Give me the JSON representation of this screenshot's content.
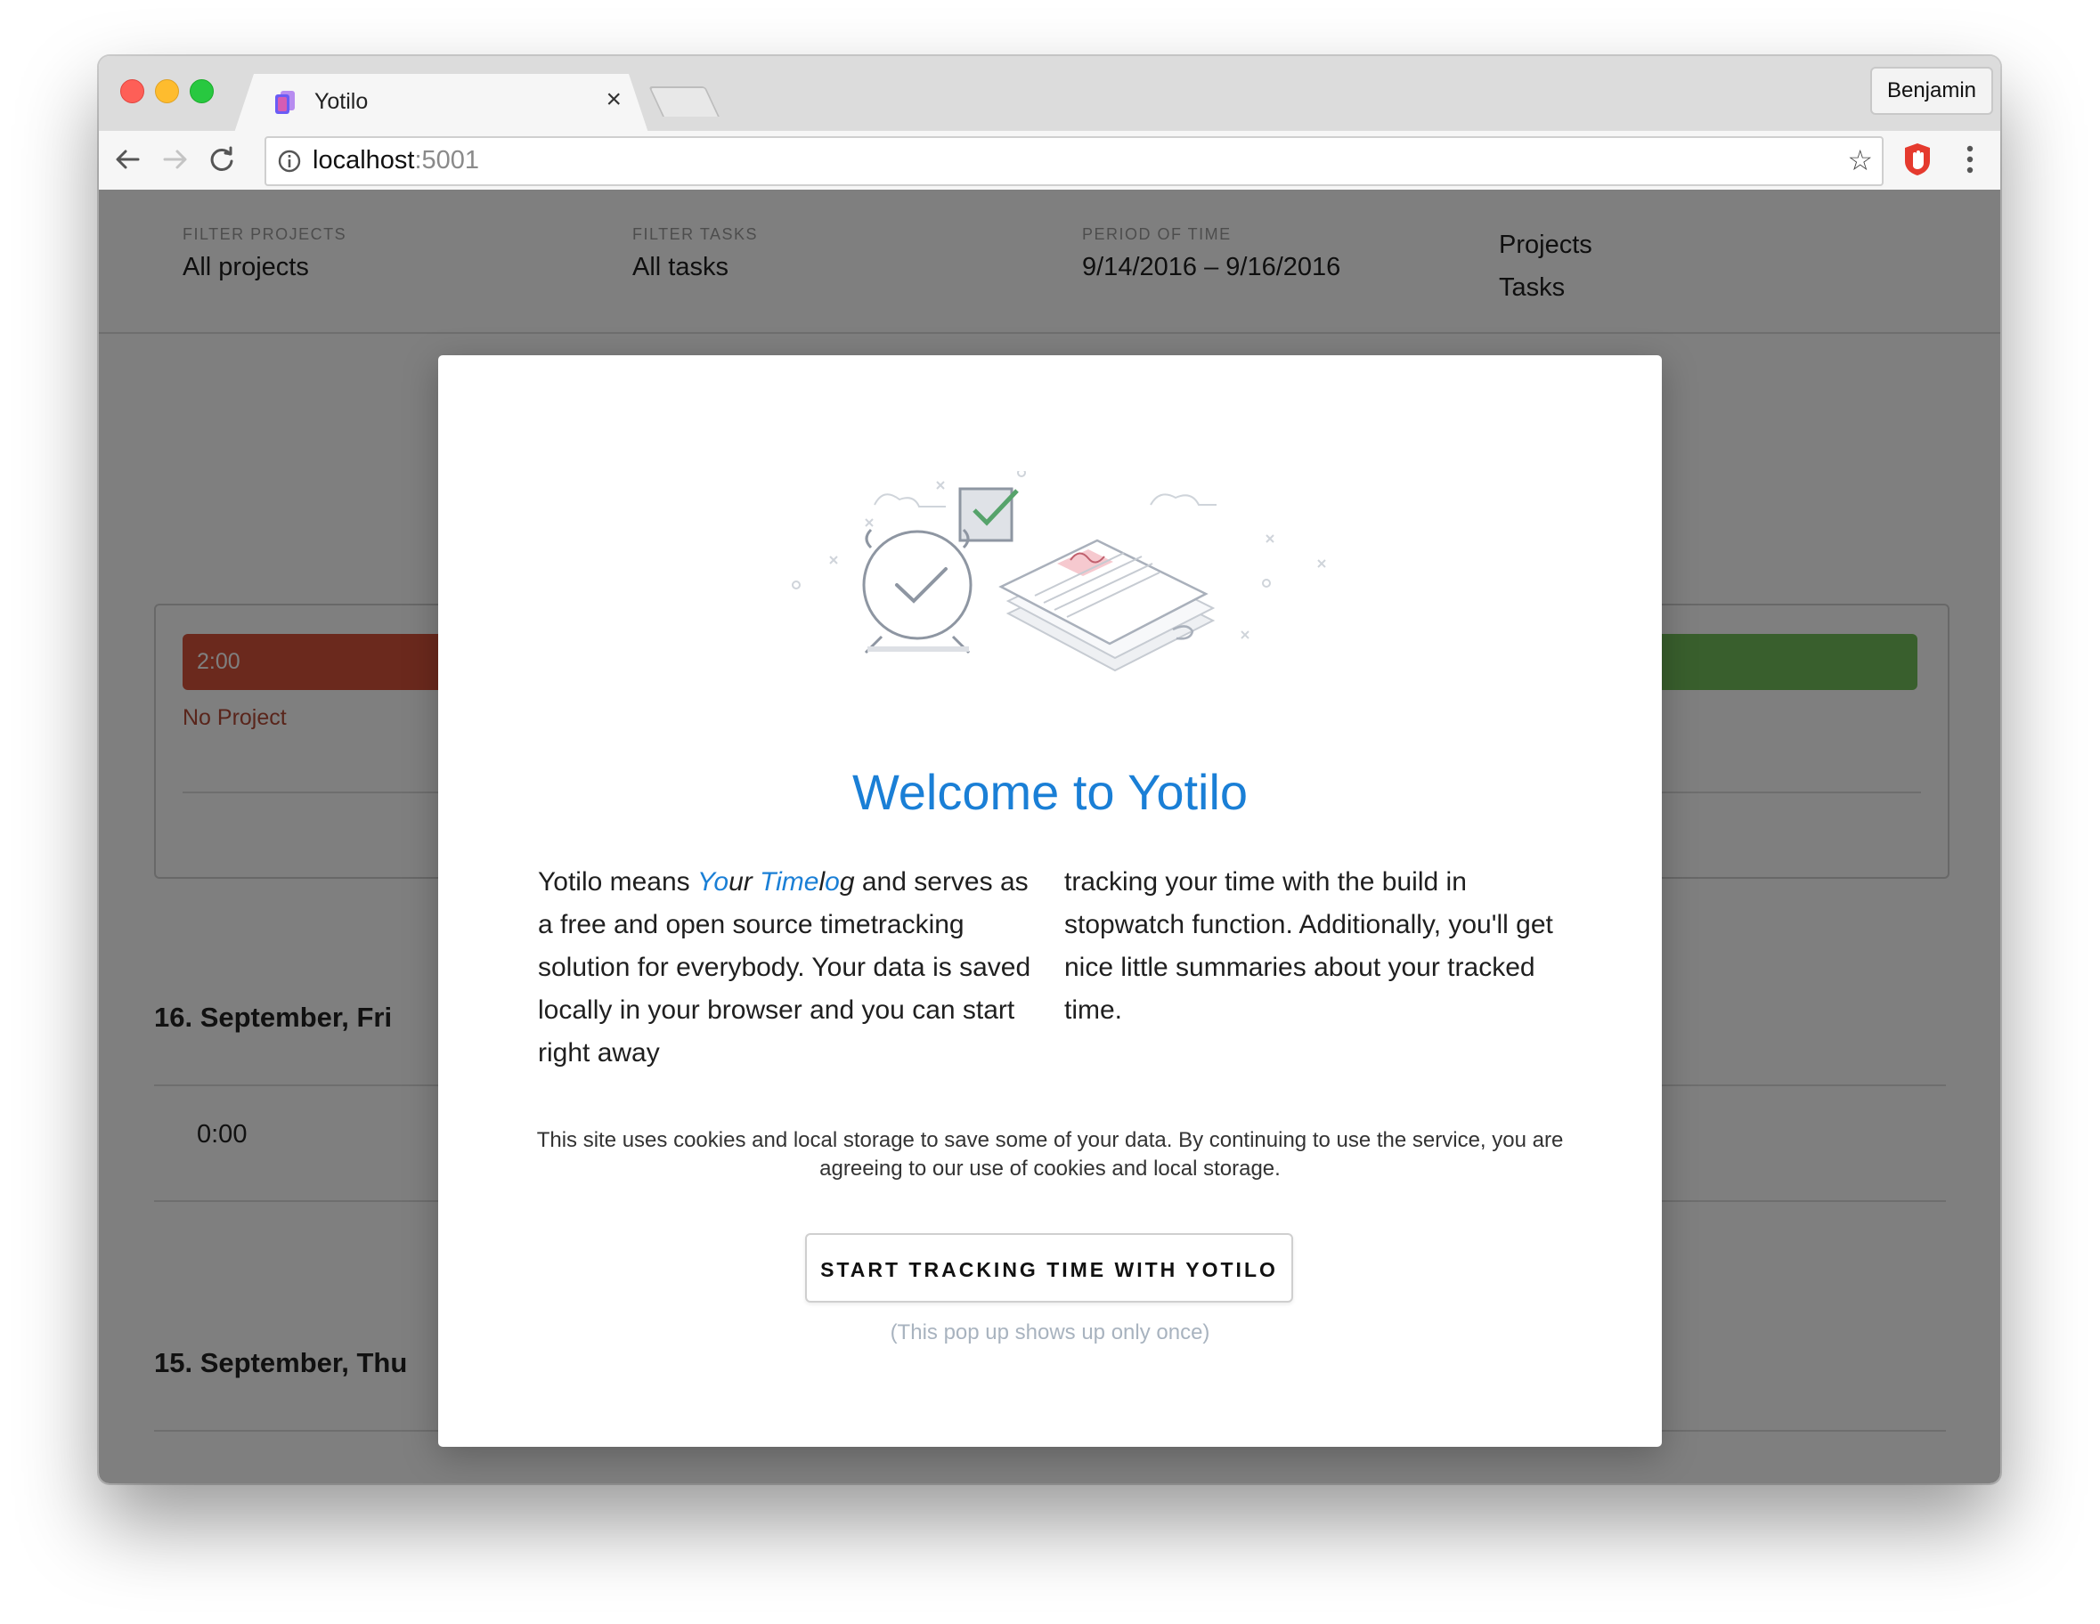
{
  "browser": {
    "tab_title": "Yotilo",
    "tab_close": "×",
    "profile_name": "Benjamin",
    "url_host": "localhost",
    "url_port": ":5001",
    "star": "☆"
  },
  "filters": {
    "projects_label": "Filter Projects",
    "projects_value": "All projects",
    "tasks_label": "Filter Tasks",
    "tasks_value": "All tasks",
    "period_label": "Period of time",
    "period_value": "9/14/2016 – 9/16/2016"
  },
  "nav": {
    "projects": "Projects",
    "tasks": "Tasks"
  },
  "summary": {
    "bar_time": "2:00",
    "project_name": "No Project",
    "bar_red_color": "#d6523a",
    "bar_green_color": "#73bf5b"
  },
  "days": [
    {
      "heading": "16. September, Fri",
      "entry_time": "0:00"
    },
    {
      "heading": "15. September, Thu"
    }
  ],
  "modal": {
    "title": "Welcome to Yotilo",
    "intro_before": "Yotilo means ",
    "your_hl": "Yo",
    "your_rest": "ur ",
    "time_hl": "Time",
    "log_l": "l",
    "log_o": "o",
    "log_g": "g",
    "intro_after": " and serves as a free and open source timetracking solution for everybody. Your data is saved locally in your browser and you can start right away",
    "intro_col2": "tracking your time with the build in stopwatch function. Additionally, you'll get nice little summaries about your tracked time.",
    "cookie_notice": "This site uses cookies and local storage to save some of your data. By continuing to use the service, you are agreeing to our use of cookies and local storage.",
    "cta_label": "START TRACKING TIME WITH YOTILO",
    "once_note": "(This pop up shows up only once)",
    "accent_color": "#1a7fd6"
  }
}
